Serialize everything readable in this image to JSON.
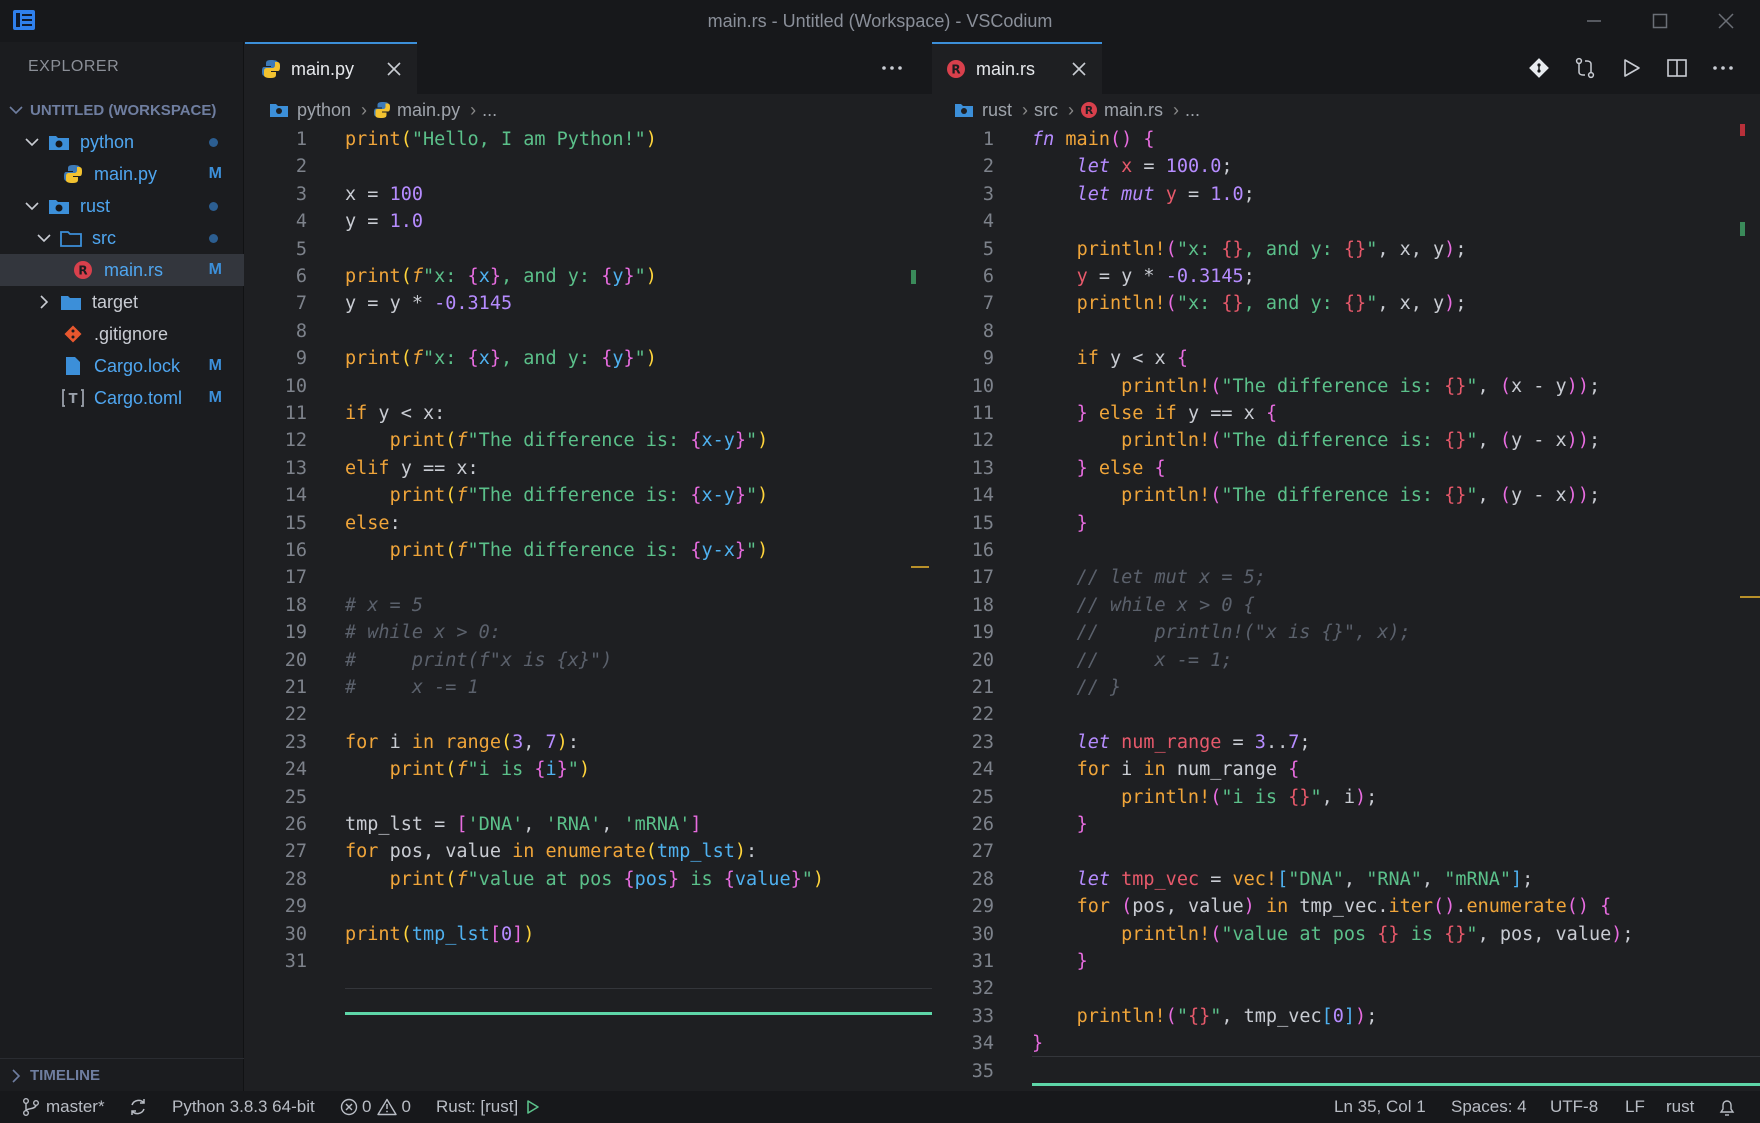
{
  "window": {
    "title": "main.rs - Untitled (Workspace) - VSCodium"
  },
  "sidebar": {
    "title": "EXPLORER",
    "workspace_label": "UNTITLED (WORKSPACE)",
    "items": [
      {
        "label": "python",
        "kind": "folder-root",
        "status": "dot"
      },
      {
        "label": "main.py",
        "kind": "python-file",
        "badge": "M"
      },
      {
        "label": "rust",
        "kind": "folder-root",
        "status": "dot"
      },
      {
        "label": "src",
        "kind": "folder",
        "status": "dot"
      },
      {
        "label": "main.rs",
        "kind": "rust-file",
        "badge": "M"
      },
      {
        "label": "target",
        "kind": "folder"
      },
      {
        "label": ".gitignore",
        "kind": "git-file"
      },
      {
        "label": "Cargo.lock",
        "kind": "file",
        "badge": "M"
      },
      {
        "label": "Cargo.toml",
        "kind": "toml-file",
        "badge": "M"
      }
    ],
    "timeline_label": "TIMELINE"
  },
  "left_editor": {
    "tab_label": "main.py",
    "breadcrumb": [
      "python",
      "main.py",
      "..."
    ],
    "lines": [
      "print(\"Hello, I am Python!\")",
      "",
      "x = 100",
      "y = 1.0",
      "",
      "print(f\"x: {x}, and y: {y}\")",
      "y = y * -0.3145",
      "",
      "print(f\"x: {x}, and y: {y}\")",
      "",
      "if y < x:",
      "    print(f\"The difference is: {x-y}\")",
      "elif y == x:",
      "    print(f\"The difference is: {x-y}\")",
      "else:",
      "    print(f\"The difference is: {y-x}\")",
      "",
      "# x = 5",
      "# while x > 0:",
      "#     print(f\"x is {x}\")",
      "#     x -= 1",
      "",
      "for i in range(3, 7):",
      "    print(f\"i is {i}\")",
      "",
      "tmp_lst = ['DNA', 'RNA', 'mRNA']",
      "for pos, value in enumerate(tmp_lst):",
      "    print(f\"value at pos {pos} is {value}\")",
      "",
      "print(tmp_lst[0])",
      ""
    ]
  },
  "right_editor": {
    "tab_label": "main.rs",
    "breadcrumb": [
      "rust",
      "src",
      "main.rs",
      "..."
    ],
    "lines": [
      "fn main() {",
      "    let x = 100.0;",
      "    let mut y = 1.0;",
      "",
      "    println!(\"x: {}, and y: {}\", x, y);",
      "    y = y * -0.3145;",
      "    println!(\"x: {}, and y: {}\", x, y);",
      "",
      "    if y < x {",
      "        println!(\"The difference is: {}\", (x - y));",
      "    } else if y == x {",
      "        println!(\"The difference is: {}\", (y - x));",
      "    } else {",
      "        println!(\"The difference is: {}\", (y - x));",
      "    }",
      "",
      "    // let mut x = 5;",
      "    // while x > 0 {",
      "    //     println!(\"x is {}\", x);",
      "    //     x -= 1;",
      "    // }",
      "",
      "    let num_range = 3..7;",
      "    for i in num_range {",
      "        println!(\"i is {}\", i);",
      "    }",
      "",
      "    let tmp_vec = vec![\"DNA\", \"RNA\", \"mRNA\"];",
      "    for (pos, value) in tmp_vec.iter().enumerate() {",
      "        println!(\"value at pos {} is {}\", pos, value);",
      "    }",
      "",
      "    println!(\"{}\", tmp_vec[0]);",
      "}",
      ""
    ]
  },
  "statusbar": {
    "branch": "master*",
    "python": "Python 3.8.3 64-bit",
    "errors": "0",
    "warnings": "0",
    "rust": "Rust: [rust]",
    "position": "Ln 35, Col 1",
    "spaces": "Spaces: 4",
    "encoding": "UTF-8",
    "eol": "LF",
    "language": "rust"
  },
  "colors": {
    "accent": "#3c8fd9",
    "modified_badge": "#3c8fd9",
    "cursor_line": "#5ed6a8"
  }
}
